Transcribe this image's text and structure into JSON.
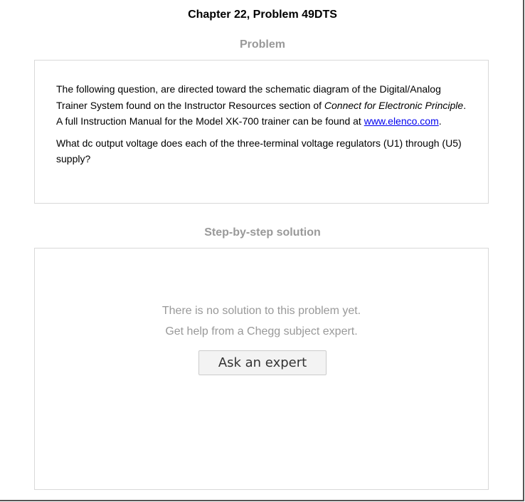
{
  "page": {
    "title": "Chapter 22, Problem 49DTS"
  },
  "problem": {
    "heading": "Problem",
    "paragraph1": {
      "text_before_italic": "The following question, are directed toward the schematic diagram of the Digital/Analog Trainer System found on the Instructor Resources section of ",
      "italic_text": "Connect for Electronic Principle",
      "text_after_italic": ". A full Instruction Manual for the Model XK-700 trainer can be found at ",
      "link_text": "www.elenco.com",
      "text_end": "."
    },
    "paragraph2": "What dc output voltage does each of the three-terminal voltage regulators (U1) through (U5) supply?"
  },
  "solution": {
    "heading": "Step-by-step solution",
    "empty_message_line1": "There is no solution to this problem yet.",
    "empty_message_line2": "Get help from a Chegg subject expert.",
    "ask_button_label": "Ask an expert"
  },
  "colors": {
    "heading_gray": "#999999",
    "link_blue": "#0000ee",
    "card_border": "#d9d9d9",
    "button_bg": "#f3f3f3"
  }
}
